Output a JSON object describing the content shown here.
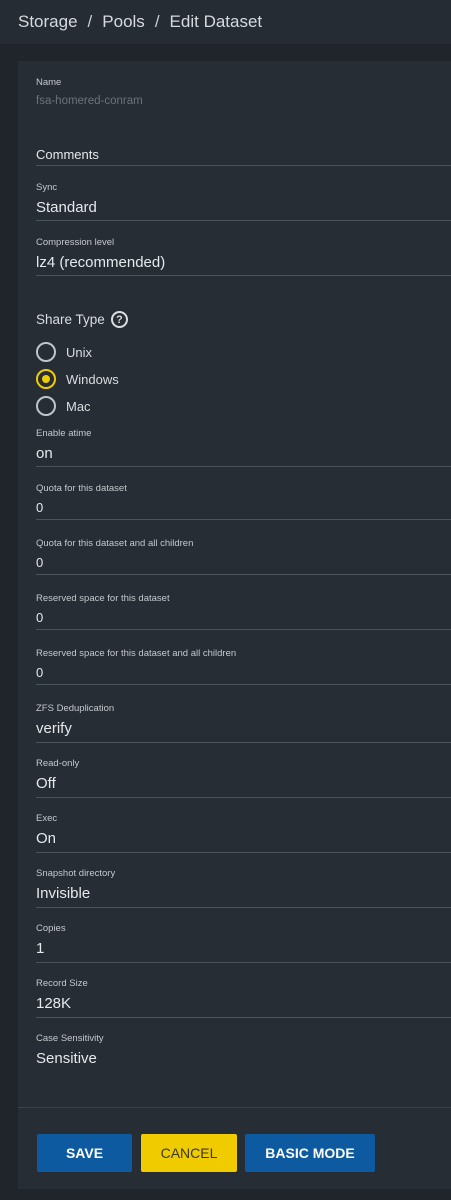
{
  "breadcrumb": {
    "items": [
      "Storage",
      "Pools",
      "Edit Dataset"
    ],
    "sep": "/"
  },
  "name": {
    "label": "Name",
    "value": "fsa-homered-conram"
  },
  "comments": {
    "label": "Comments"
  },
  "sync": {
    "label": "Sync",
    "value": "Standard"
  },
  "compression": {
    "label": "Compression level",
    "value": "lz4 (recommended)"
  },
  "share_type": {
    "label": "Share Type",
    "help_icon": "help-circle-icon",
    "options": [
      "Unix",
      "Windows",
      "Mac"
    ],
    "selected": "Windows"
  },
  "atime": {
    "label": "Enable atime",
    "value": "on"
  },
  "quota": {
    "label": "Quota for this dataset",
    "value": "0"
  },
  "quota_children": {
    "label": "Quota for this dataset and all children",
    "value": "0"
  },
  "reserved": {
    "label": "Reserved space for this dataset",
    "value": "0"
  },
  "reserved_children": {
    "label": "Reserved space for this dataset and all children",
    "value": "0"
  },
  "dedup": {
    "label": "ZFS Deduplication",
    "value": "verify"
  },
  "readonly": {
    "label": "Read-only",
    "value": "Off"
  },
  "exec": {
    "label": "Exec",
    "value": "On"
  },
  "snapdir": {
    "label": "Snapshot directory",
    "value": "Invisible"
  },
  "copies": {
    "label": "Copies",
    "value": "1"
  },
  "recordsize": {
    "label": "Record Size",
    "value": "128K"
  },
  "casesensitivity": {
    "label": "Case Sensitivity",
    "value": "Sensitive"
  },
  "buttons": {
    "save": "SAVE",
    "cancel": "CANCEL",
    "basic": "BASIC MODE"
  },
  "colors": {
    "accent": "#f0cb00",
    "primary": "#0e5aa0",
    "background": "#1f252b",
    "card": "#262d34"
  }
}
